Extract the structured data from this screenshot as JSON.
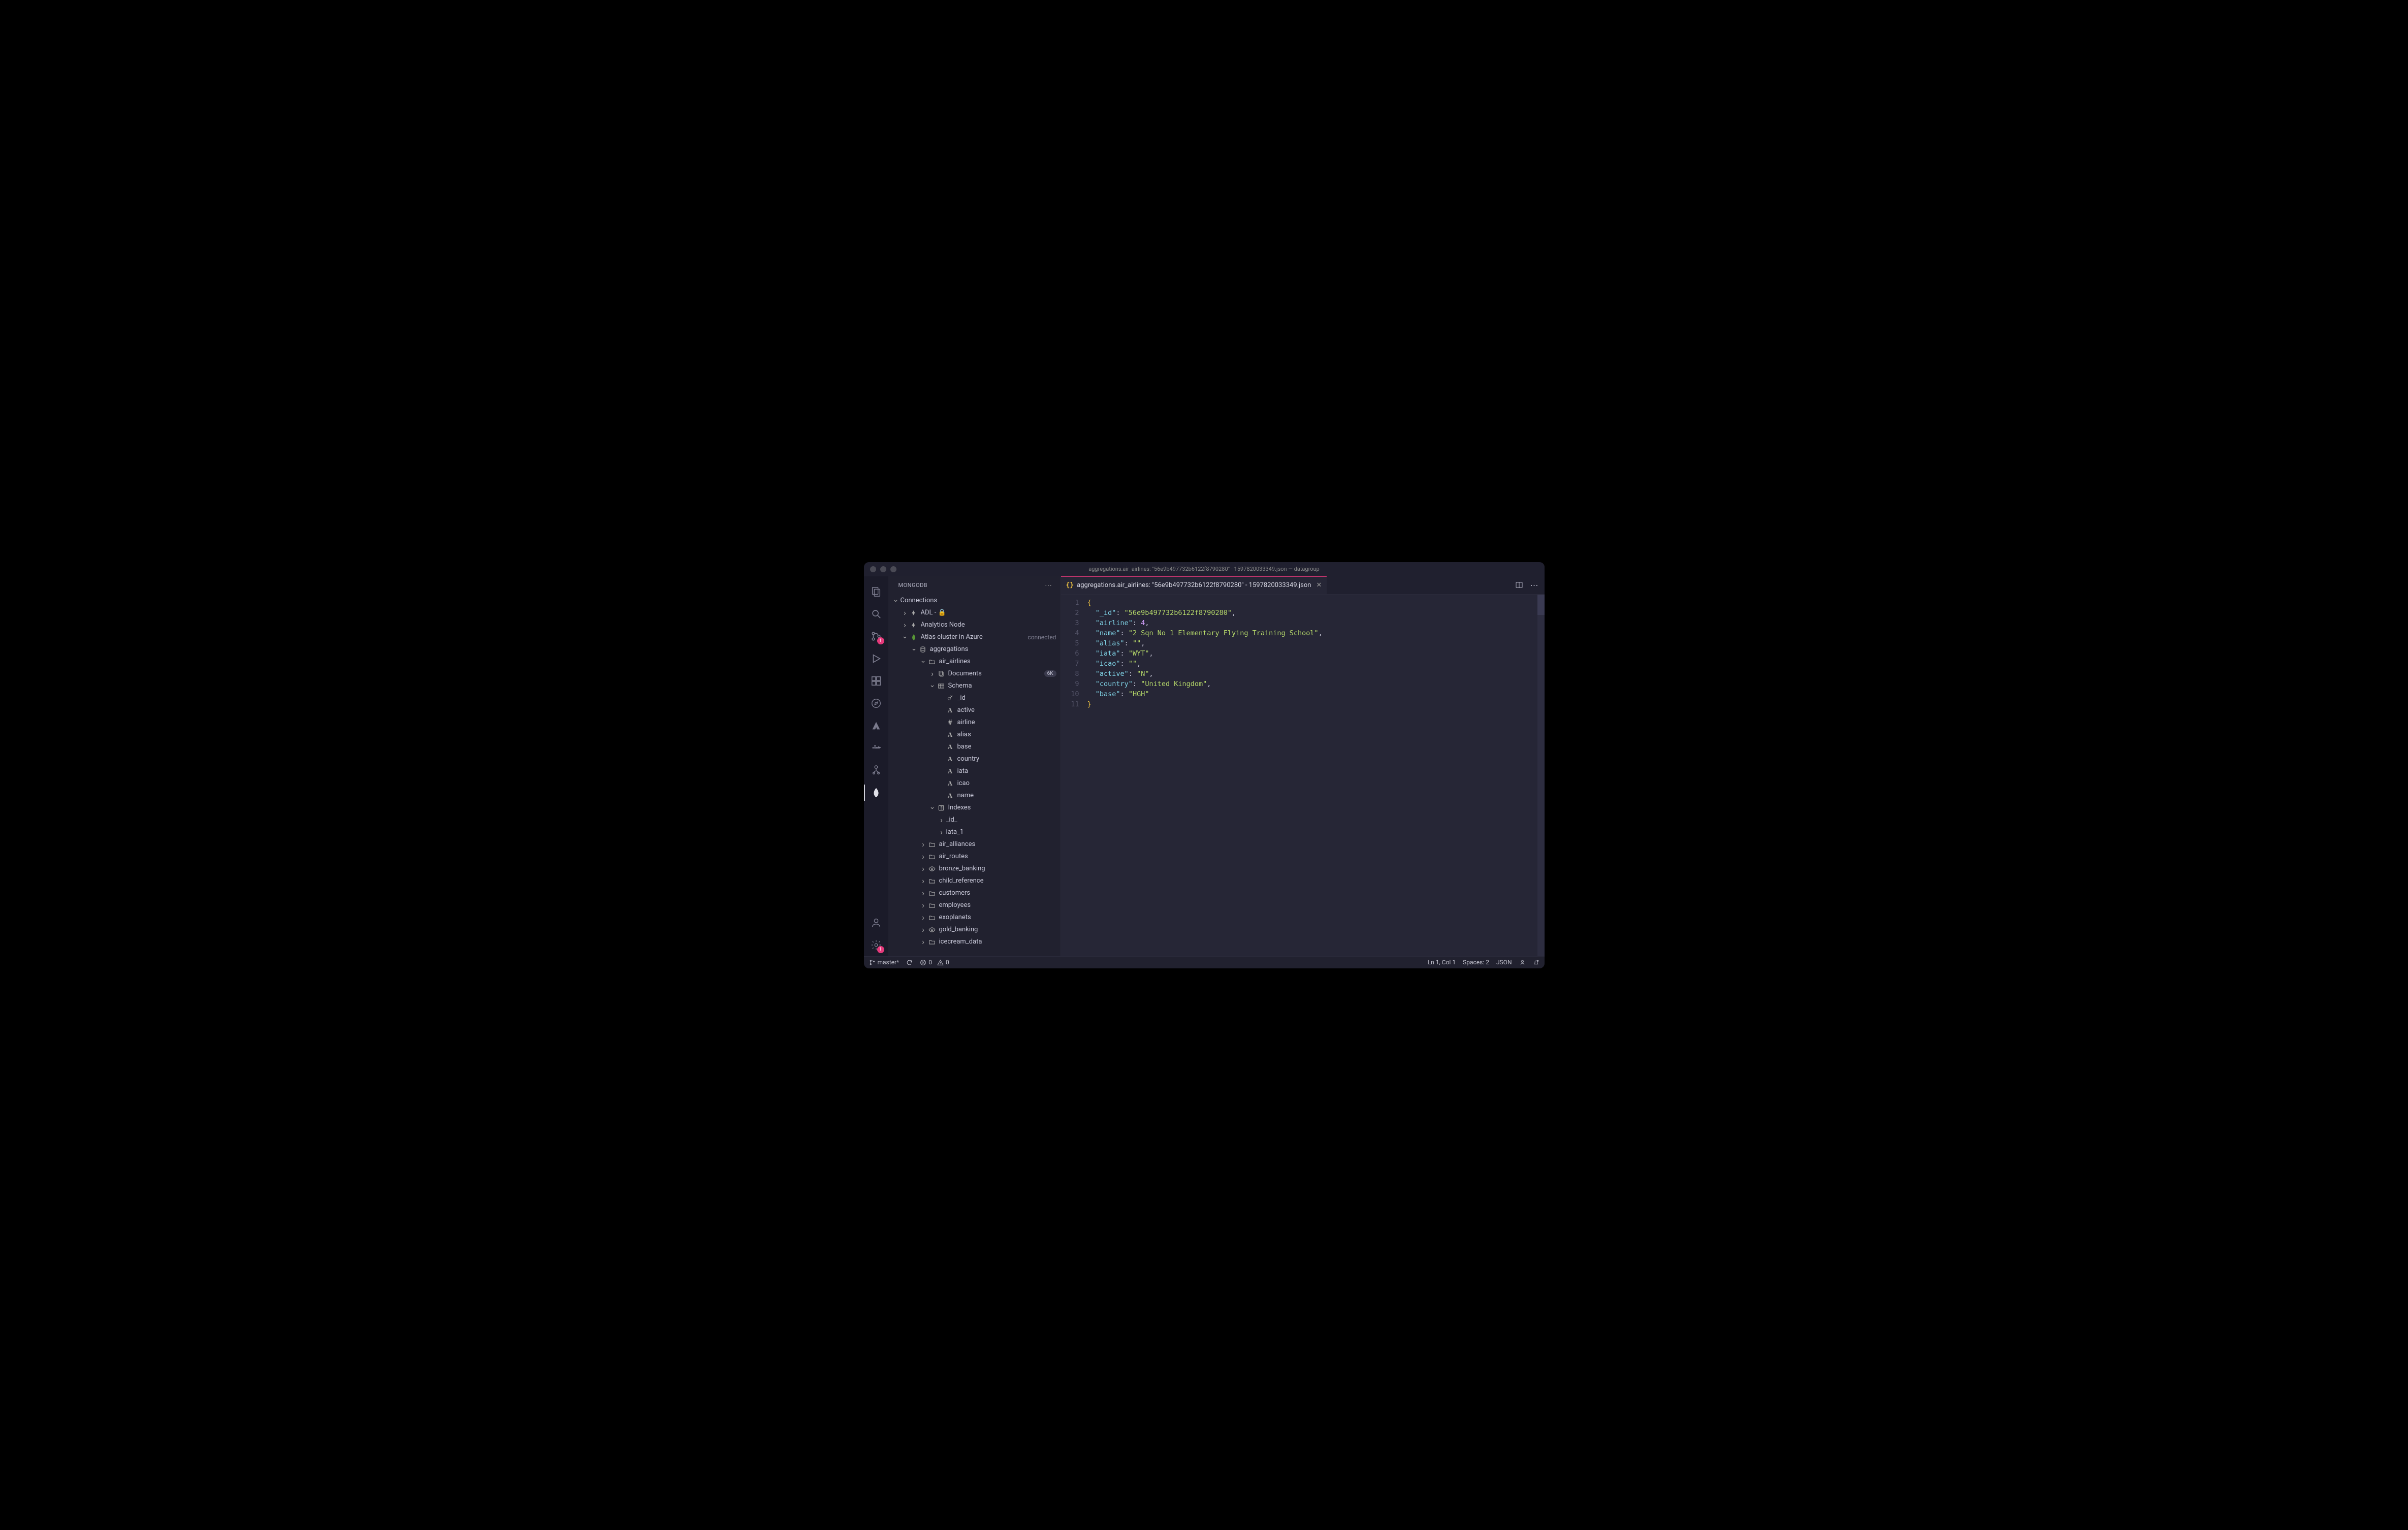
{
  "window_title": "aggregations.air_airlines: \"56e9b497732b6122f8790280\" - 1597820033349.json — datagroup",
  "sidebar": {
    "title": "MONGODB",
    "section": "Connections"
  },
  "activity_badges": {
    "scm": "1",
    "settings": "1"
  },
  "tree": [
    {
      "depth": 1,
      "chev": "right",
      "icon": "bolt",
      "label": "ADL - 🔒"
    },
    {
      "depth": 1,
      "chev": "right",
      "icon": "bolt",
      "label": "Analytics Node"
    },
    {
      "depth": 1,
      "chev": "down",
      "icon": "leaf",
      "label": "Atlas cluster in Azure",
      "meta": "connected"
    },
    {
      "depth": 2,
      "chev": "down",
      "icon": "db",
      "label": "aggregations"
    },
    {
      "depth": 3,
      "chev": "down",
      "icon": "folder",
      "label": "air_airlines"
    },
    {
      "depth": 4,
      "chev": "right",
      "icon": "docs",
      "label": "Documents",
      "pill": "6K"
    },
    {
      "depth": 4,
      "chev": "down",
      "icon": "table",
      "label": "Schema"
    },
    {
      "depth": 5,
      "chev": "",
      "icon": "key",
      "label": "_id"
    },
    {
      "depth": 5,
      "chev": "",
      "icon": "A",
      "label": "active"
    },
    {
      "depth": 5,
      "chev": "",
      "icon": "hash",
      "label": "airline"
    },
    {
      "depth": 5,
      "chev": "",
      "icon": "A",
      "label": "alias"
    },
    {
      "depth": 5,
      "chev": "",
      "icon": "A",
      "label": "base"
    },
    {
      "depth": 5,
      "chev": "",
      "icon": "A",
      "label": "country"
    },
    {
      "depth": 5,
      "chev": "",
      "icon": "A",
      "label": "iata"
    },
    {
      "depth": 5,
      "chev": "",
      "icon": "A",
      "label": "icao"
    },
    {
      "depth": 5,
      "chev": "",
      "icon": "A",
      "label": "name"
    },
    {
      "depth": 4,
      "chev": "down",
      "icon": "index",
      "label": "Indexes"
    },
    {
      "depth": 5,
      "chev": "right",
      "icon": "",
      "label": "_id_"
    },
    {
      "depth": 5,
      "chev": "right",
      "icon": "",
      "label": "iata_1"
    },
    {
      "depth": 3,
      "chev": "right",
      "icon": "folder",
      "label": "air_alliances"
    },
    {
      "depth": 3,
      "chev": "right",
      "icon": "folder",
      "label": "air_routes"
    },
    {
      "depth": 3,
      "chev": "right",
      "icon": "eye",
      "label": "bronze_banking"
    },
    {
      "depth": 3,
      "chev": "right",
      "icon": "folder",
      "label": "child_reference"
    },
    {
      "depth": 3,
      "chev": "right",
      "icon": "folder",
      "label": "customers"
    },
    {
      "depth": 3,
      "chev": "right",
      "icon": "folder",
      "label": "employees"
    },
    {
      "depth": 3,
      "chev": "right",
      "icon": "folder",
      "label": "exoplanets"
    },
    {
      "depth": 3,
      "chev": "right",
      "icon": "eye",
      "label": "gold_banking"
    },
    {
      "depth": 3,
      "chev": "right",
      "icon": "folder",
      "label": "icecream_data"
    }
  ],
  "tab": {
    "label": "aggregations.air_airlines: \"56e9b497732b6122f8790280\" - 1597820033349.json"
  },
  "editor": {
    "lines": [
      "1",
      "2",
      "3",
      "4",
      "5",
      "6",
      "7",
      "8",
      "9",
      "10",
      "11"
    ],
    "json": {
      "_id": "56e9b497732b6122f8790280",
      "airline": 4,
      "name": "2 Sqn No 1 Elementary Flying Training School",
      "alias": "",
      "iata": "WYT",
      "icao": "",
      "active": "N",
      "country": "United Kingdom",
      "base": "HGH"
    }
  },
  "status": {
    "branch": "master*",
    "errors": "0",
    "warnings": "0",
    "position": "Ln 1, Col 1",
    "spaces": "Spaces: 2",
    "language": "JSON"
  }
}
